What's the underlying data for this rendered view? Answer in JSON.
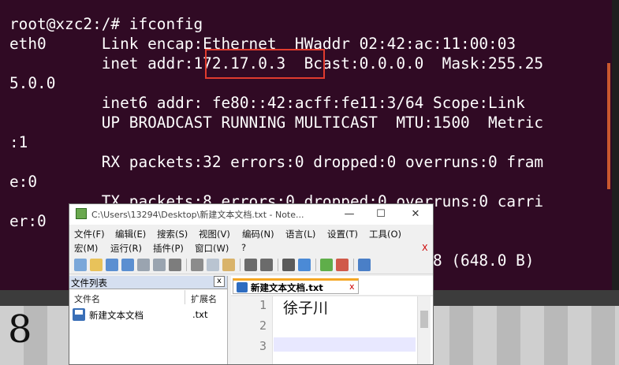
{
  "terminal": {
    "lines": [
      "root@xzc2:/# ifconfig",
      "eth0      Link encap:Ethernet  HWaddr 02:42:ac:11:00:03",
      "          inet addr:172.17.0.3  Bcast:0.0.0.0  Mask:255.25",
      "5.0.0",
      "          inet6 addr: fe80::42:acff:fe11:3/64 Scope:Link",
      "          UP BROADCAST RUNNING MULTICAST  MTU:1500  Metric",
      ":1",
      "          RX packets:32 errors:0 dropped:0 overruns:0 fram",
      "e:0",
      "          TX packets:8 errors:0 dropped:0 overruns:0 carri",
      "er:0",
      "",
      "                                          s:648 (648.0 B)"
    ]
  },
  "notepad": {
    "title": "C:\\Users\\13294\\Desktop\\新建文本文档.txt - Note...",
    "window_buttons": {
      "minimize": "—",
      "maximize": "☐",
      "close": "✕"
    },
    "menu_row1": [
      "文件(F)",
      "编辑(E)",
      "搜索(S)",
      "视图(V)",
      "编码(N)",
      "语言(L)",
      "设置(T)",
      "工具(O)"
    ],
    "menu_row2": [
      "宏(M)",
      "运行(R)",
      "插件(P)",
      "窗口(W)",
      "?"
    ],
    "menu_close": "X",
    "file_panel": {
      "title": "文件列表",
      "close": "x",
      "col_name": "文件名",
      "col_ext": "扩展名",
      "files": [
        {
          "name": "新建文本文档",
          "ext": ".txt"
        }
      ]
    },
    "tab": {
      "label": "新建文本文档.txt",
      "close": "x"
    },
    "line_numbers": [
      "1",
      "2",
      "3"
    ],
    "content": [
      "徐子川"
    ]
  },
  "background": {
    "numeral": "8"
  },
  "colors": {
    "terminal_bg": "#300a24",
    "highlight": "#e03b2e",
    "tab_accent": "#f5a623"
  }
}
